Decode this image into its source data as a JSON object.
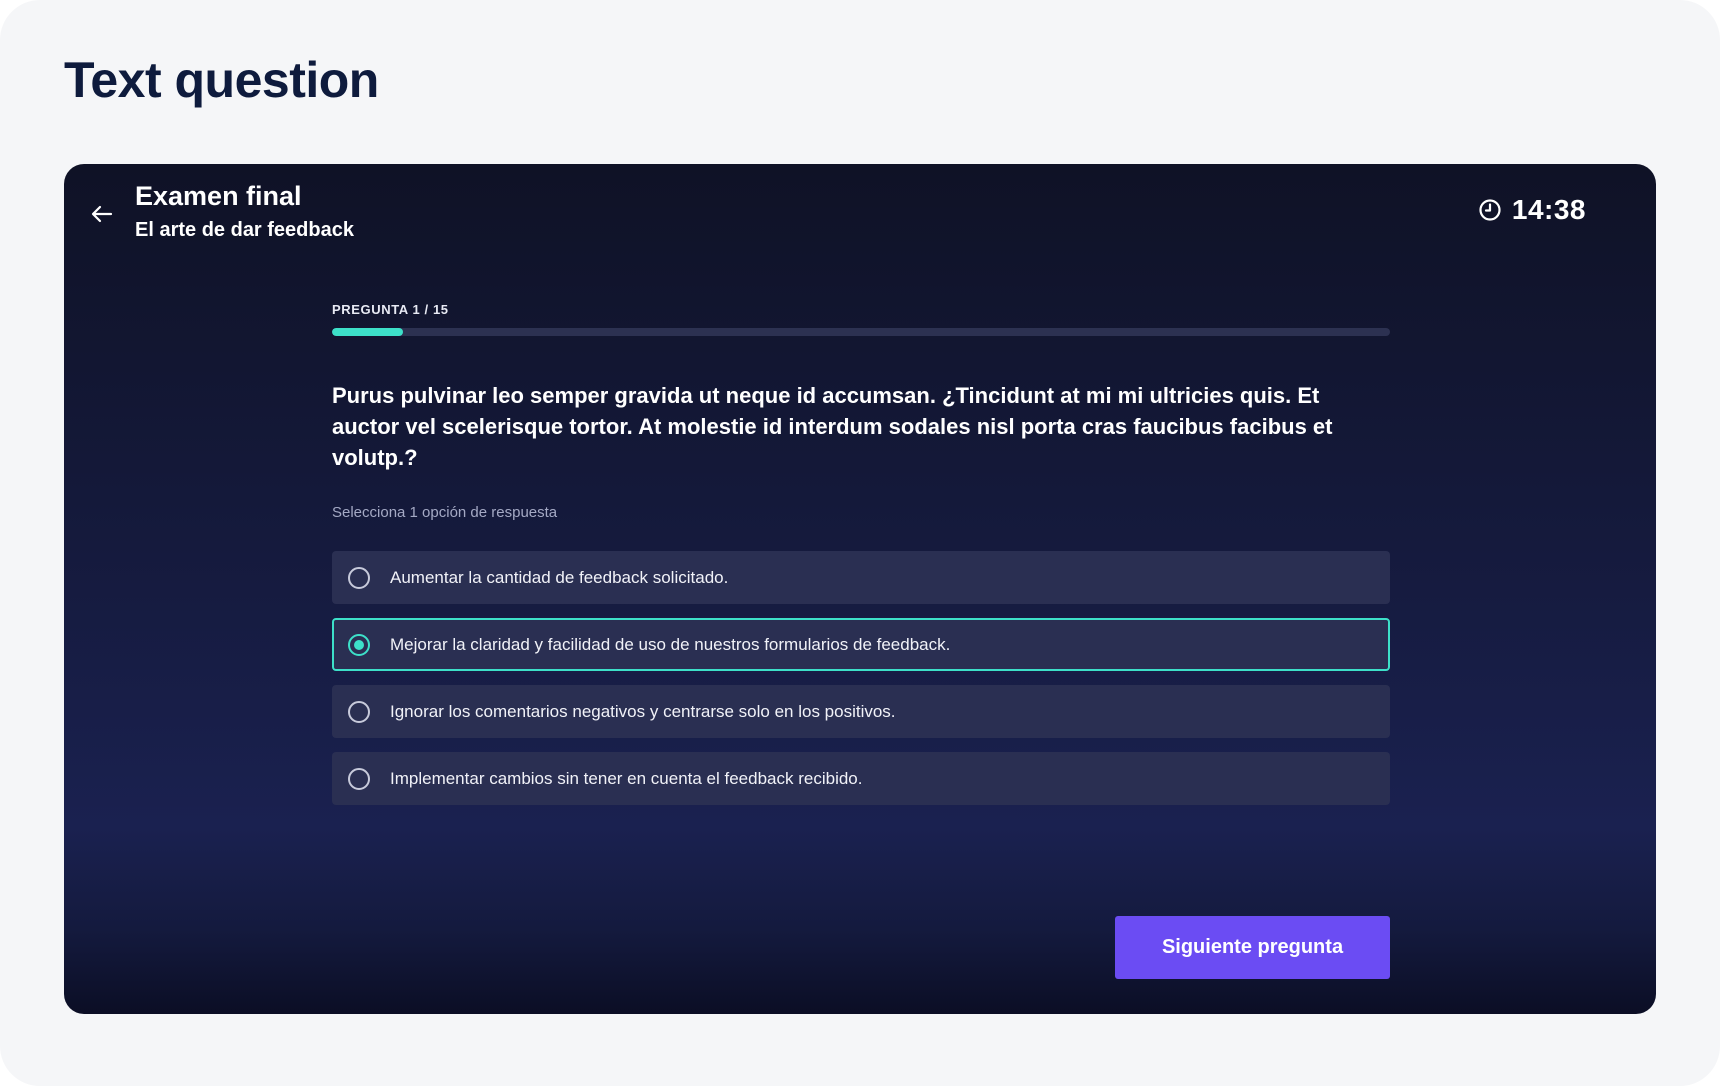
{
  "page": {
    "title": "Text question"
  },
  "exam": {
    "title": "Examen final",
    "subtitle": "El arte de dar feedback",
    "timer": "14:38"
  },
  "question": {
    "counter": "PREGUNTA 1 / 15",
    "current": 1,
    "total": 15,
    "progress_fraction": 0.0667,
    "text": "Purus pulvinar leo semper gravida ut neque id accumsan. ¿Tincidunt at mi mi ultricies quis. Et auctor vel scelerisque tortor. At molestie id interdum sodales nisl porta cras faucibus facibus et volutp.?",
    "instructions": "Selecciona 1 opción de respuesta",
    "options": [
      {
        "label": "Aumentar la cantidad de feedback solicitado.",
        "selected": false
      },
      {
        "label": "Mejorar la claridad y facilidad de uso de nuestros formularios de feedback.",
        "selected": true
      },
      {
        "label": "Ignorar los comentarios negativos y centrarse solo en los positivos.",
        "selected": false
      },
      {
        "label": "Implementar cambios sin tener en cuenta el feedback recibido.",
        "selected": false
      }
    ]
  },
  "actions": {
    "next_label": "Siguiente pregunta"
  },
  "icons": {
    "back": "arrow-left-icon",
    "timer": "clock-icon"
  },
  "colors": {
    "accent": "#3de0c9",
    "primary_button": "#6b4cf3",
    "page_title": "#0e1b3d",
    "option_background": "#2a2f52"
  }
}
